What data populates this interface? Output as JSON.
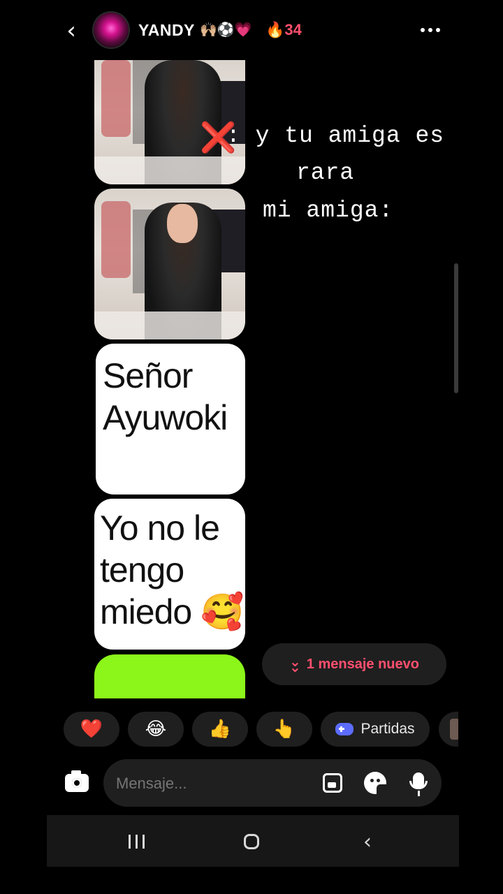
{
  "header": {
    "name": "YANDY",
    "name_emojis": "🙌🏼⚽💗",
    "streak_icon": "🔥",
    "streak_count": "34",
    "back_icon": "chevron-left-icon",
    "more_icon": "more-horizontal-icon"
  },
  "caption": {
    "marker": "❌",
    "line1": ": y tu amiga es",
    "line2": "rara",
    "line3": "mi amiga:"
  },
  "stickers": {
    "text1": [
      "Señor",
      "Ayuwoki"
    ],
    "text2": [
      "Yo no le",
      "tengo",
      "miedo 🥰"
    ]
  },
  "new_message": {
    "icon": "double-chevron-down-icon",
    "label": "1 mensaje nuevo"
  },
  "reactions": [
    {
      "emoji": "❤️"
    },
    {
      "emoji": "😂"
    },
    {
      "emoji": "👍"
    },
    {
      "emoji": "👆"
    }
  ],
  "games_chip": {
    "label": "Partidas",
    "icon": "gamepad-icon"
  },
  "composer": {
    "placeholder": "Mensaje...",
    "camera_icon": "camera-icon",
    "gallery_icon": "gallery-icon",
    "sticker_icon": "sticker-icon",
    "mic_icon": "mic-icon"
  },
  "colors": {
    "background": "#000000",
    "accent": "#ff4f6e",
    "chip_bg": "#1f1f1f",
    "sticker_green": "#8cf51a"
  }
}
